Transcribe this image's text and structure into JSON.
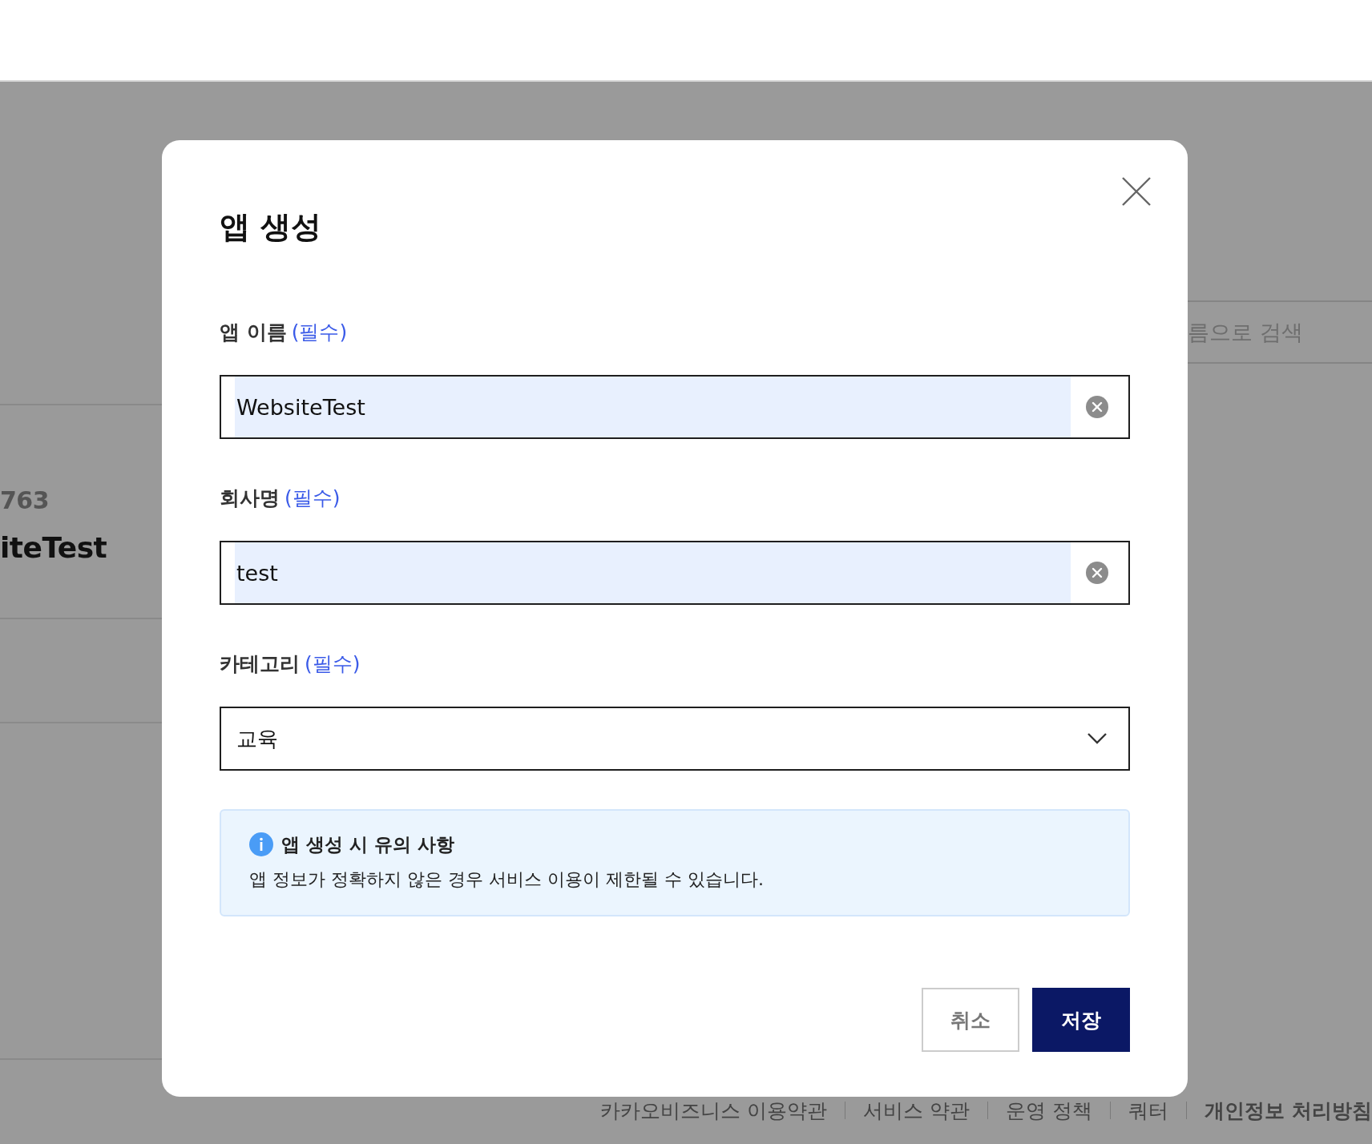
{
  "background": {
    "left_panel": {
      "number": "763",
      "app_name": "iteTest"
    },
    "search": {
      "placeholder": "름으로 검색"
    },
    "footer_links": [
      {
        "label": "카카오비즈니스 이용약관",
        "bold": false
      },
      {
        "label": "서비스 약관",
        "bold": false
      },
      {
        "label": "운영 정책",
        "bold": false
      },
      {
        "label": "쿼터",
        "bold": false
      },
      {
        "label": "개인정보 처리방침",
        "bold": true
      }
    ]
  },
  "dialog": {
    "title": "앱 생성",
    "fields": [
      {
        "kind": "text",
        "label": "앱 이름",
        "required": "(필수)",
        "value": "WebsiteTest",
        "autofilled": true
      },
      {
        "kind": "text",
        "label": "회사명",
        "required": "(필수)",
        "value": "test",
        "autofilled": true
      },
      {
        "kind": "select",
        "label": "카테고리",
        "required": "(필수)",
        "value": "교육"
      }
    ],
    "notice": {
      "title": "앱 생성 시 유의 사항",
      "text": "앱 정보가 정확하지 않은 경우 서비스 이용이 제한될 수 있습니다."
    },
    "buttons": [
      {
        "label": "취소",
        "kind": "secondary"
      },
      {
        "label": "저장",
        "kind": "primary"
      }
    ]
  }
}
